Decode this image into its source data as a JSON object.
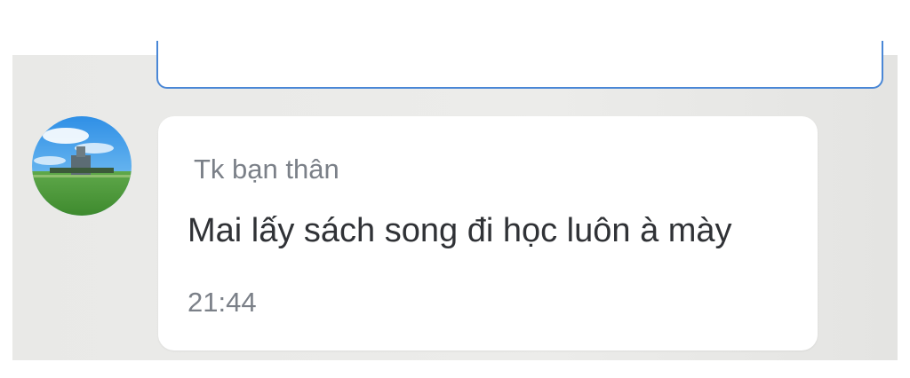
{
  "message": {
    "sender": "Tk bạn thân",
    "text": "Mai lấy sách song đi học luôn à mày",
    "time": "21:44",
    "avatar_icon": "profile-photo-landscape"
  },
  "colors": {
    "chat_background": "#eaeae8",
    "bubble_background": "#ffffff",
    "previous_bubble_border": "#4a87d6",
    "sender_text": "#7b8088",
    "message_text": "#303236"
  }
}
